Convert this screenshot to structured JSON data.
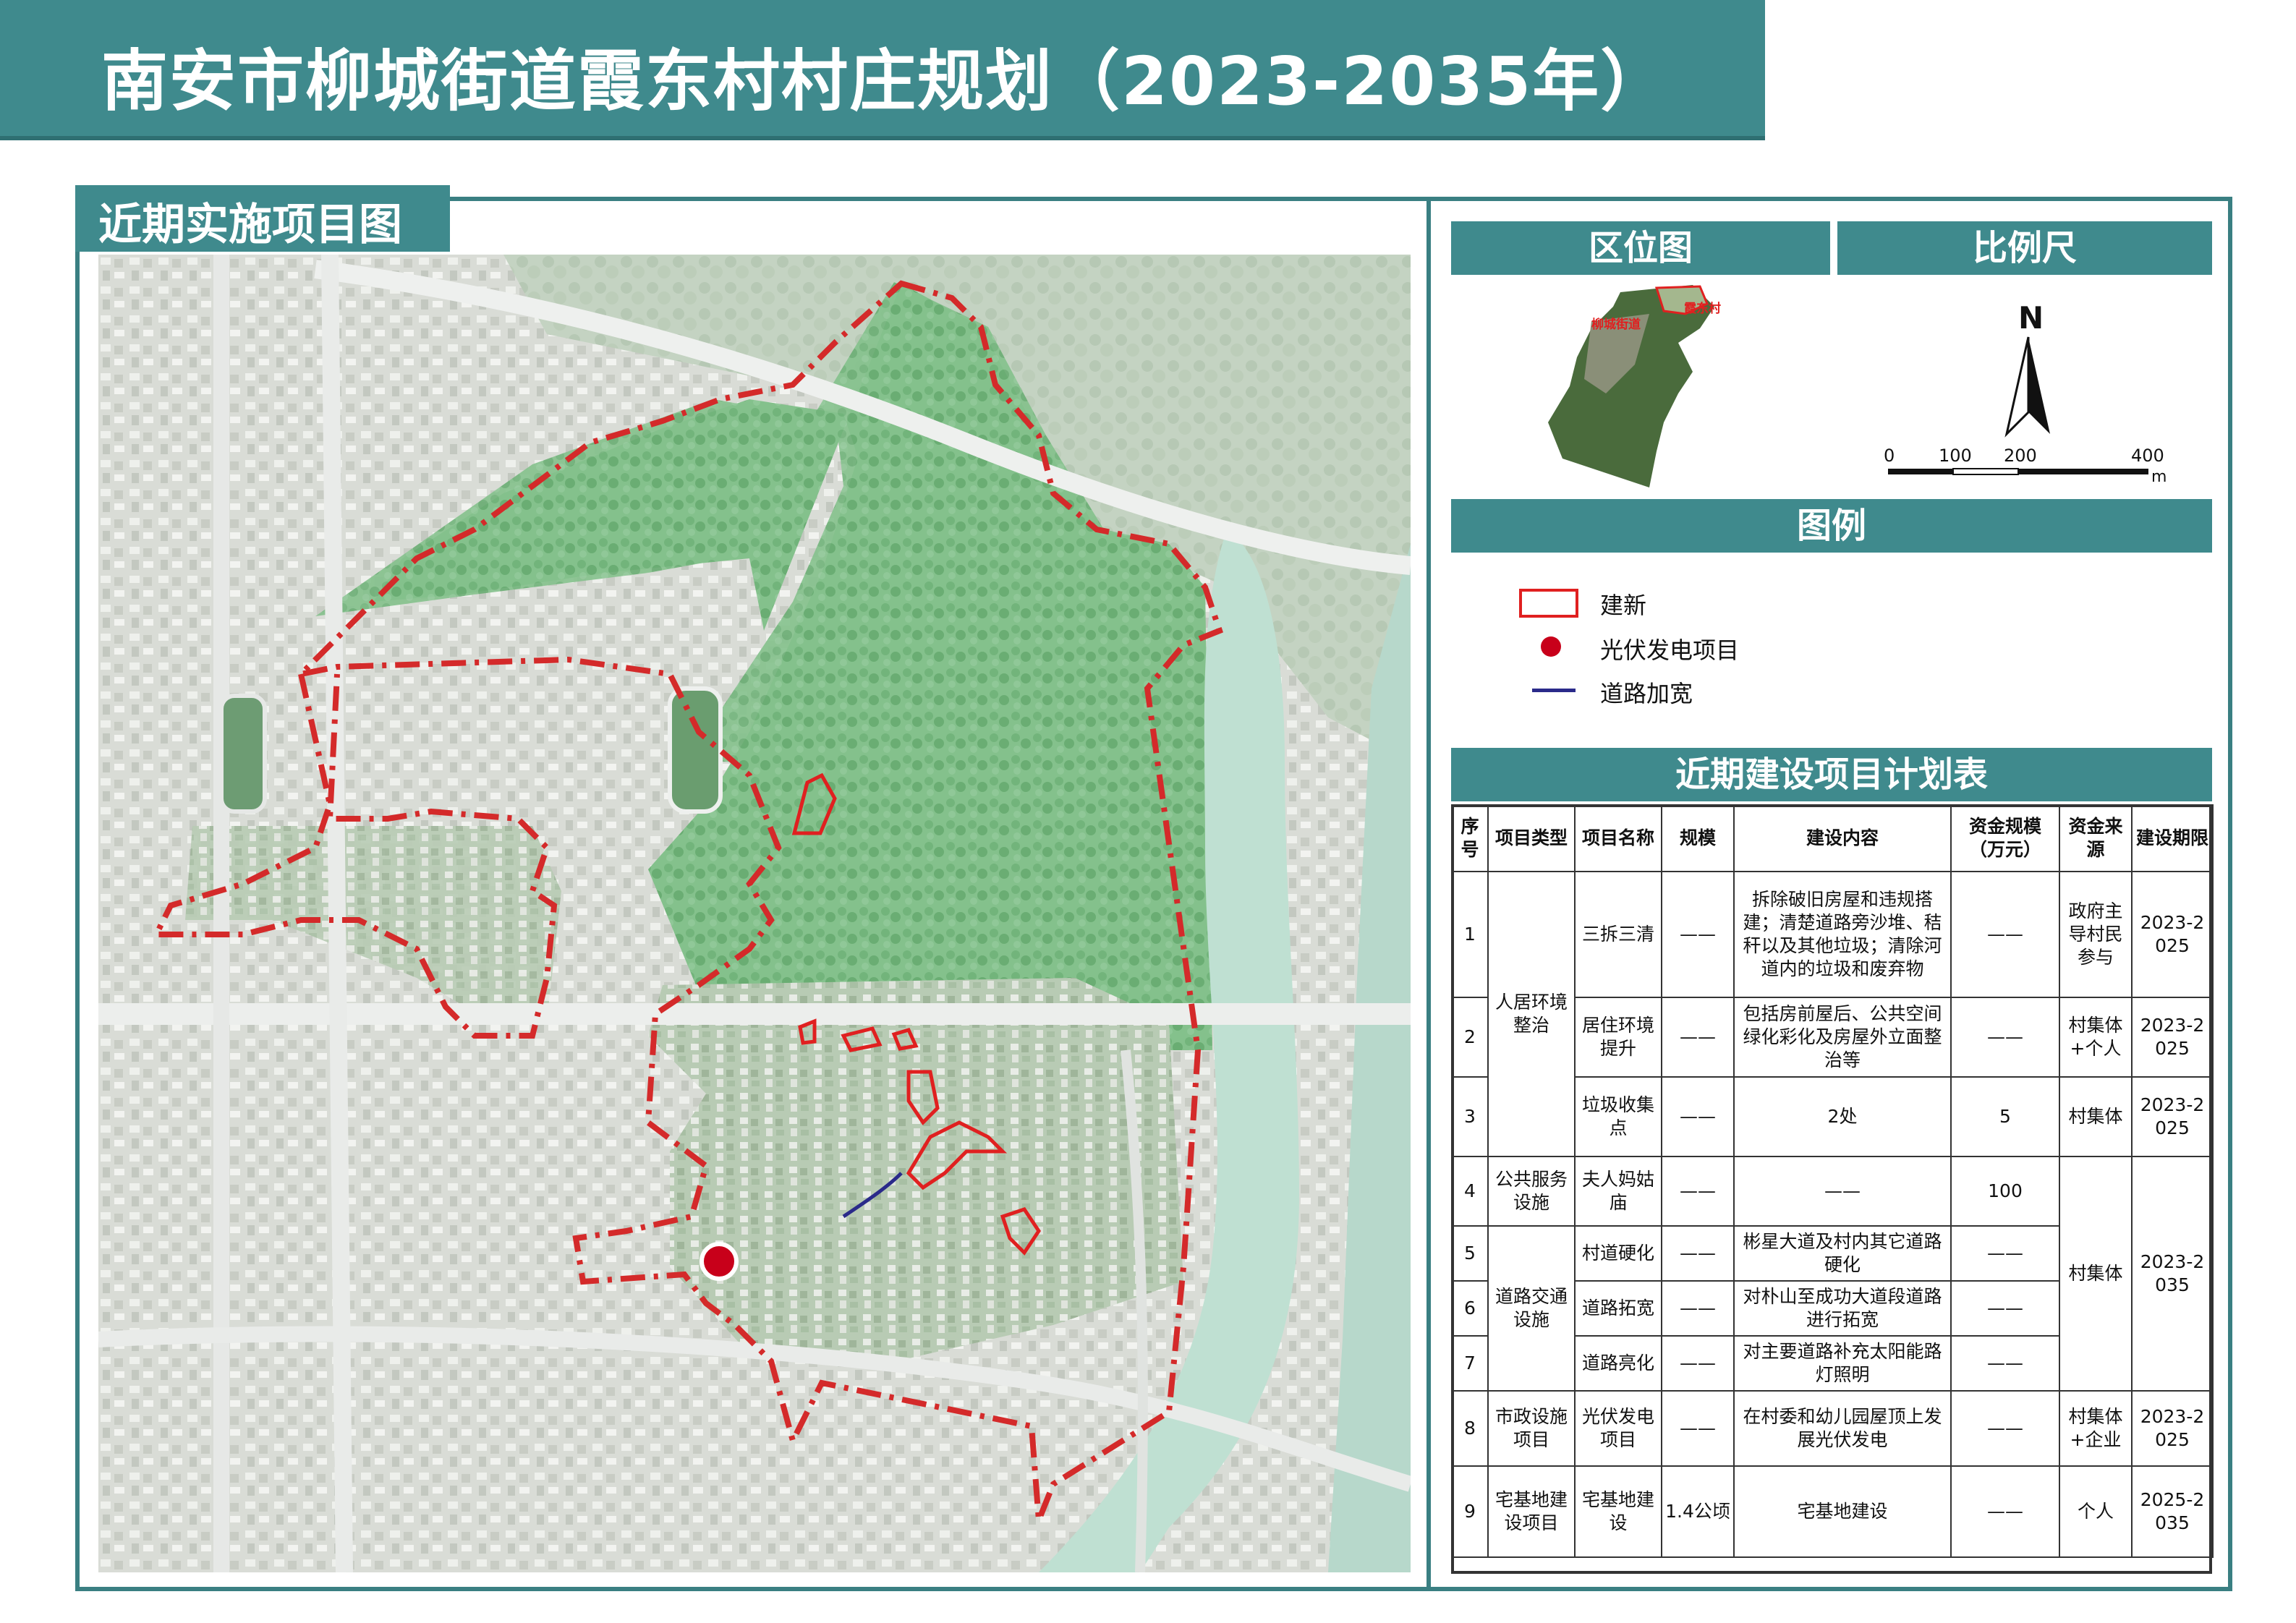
{
  "title": "南安市柳城街道霞东村村庄规划（2023-2035年）",
  "section_title": "近期实施项目图",
  "location_panel": {
    "header": "区位图",
    "label_street": "柳城街道",
    "label_village": "霞东村"
  },
  "scale_panel": {
    "header": "比例尺",
    "north": "N",
    "ticks": [
      "0",
      "100",
      "200",
      "400"
    ],
    "unit": "m"
  },
  "legend": {
    "header": "图例",
    "items": [
      {
        "label": "建新",
        "symbol": "red-outline-rect",
        "color": "#e02020"
      },
      {
        "label": "光伏发电项目",
        "symbol": "red-dot",
        "color": "#c8001a"
      },
      {
        "label": "道路加宽",
        "symbol": "blue-line",
        "color": "#2a2a8a"
      }
    ]
  },
  "colors": {
    "accent": "#3f8a8d",
    "boundary": "#d42a2a",
    "forest": "#7bbf83",
    "river": "#bfe0d2",
    "pv_dot": "#c8001a",
    "road_widen": "#2a2a8a"
  },
  "plan_table": {
    "header": "近期建设项目计划表",
    "columns": [
      "序号",
      "项目类型",
      "项目名称",
      "规模",
      "建设内容",
      "资金规模（万元）",
      "资金来源",
      "建设期限"
    ],
    "groups": {
      "g1": "人居环境整治",
      "g2": "公共服务设施",
      "g3": "道路交通设施",
      "g4": "市政设施项目",
      "g5": "宅基地建设项目"
    },
    "rows": [
      {
        "no": "1",
        "name": "三拆三清",
        "scale": "——",
        "content": "拆除破旧房屋和违规搭建；清楚道路旁沙堆、秸秆以及其他垃圾；清除河道内的垃圾和废弃物",
        "fund": "——",
        "source": "政府主导村民参与",
        "period": "2023-2025"
      },
      {
        "no": "2",
        "name": "居住环境提升",
        "scale": "——",
        "content": "包括房前屋后、公共空间绿化彩化及房屋外立面整治等",
        "fund": "——",
        "source": "村集体+个人",
        "period": "2023-2025"
      },
      {
        "no": "3",
        "name": "垃圾收集点",
        "scale": "——",
        "content": "2处",
        "fund": "5",
        "source": "村集体",
        "period": "2023-2025"
      },
      {
        "no": "4",
        "name": "夫人妈姑庙",
        "scale": "——",
        "content": "——",
        "fund": "100"
      },
      {
        "no": "5",
        "name": "村道硬化",
        "scale": "——",
        "content": "彬星大道及村内其它道路硬化",
        "fund": "——"
      },
      {
        "no": "6",
        "name": "道路拓宽",
        "scale": "——",
        "content": "对朴山至成功大道段道路进行拓宽",
        "fund": "——"
      },
      {
        "no": "7",
        "name": "道路亮化",
        "scale": "——",
        "content": "对主要道路补充太阳能路灯照明",
        "fund": "——"
      },
      {
        "no": "8",
        "name": "光伏发电项目",
        "scale": "——",
        "content": "在村委和幼儿园屋顶上发展光伏发电",
        "fund": "——",
        "source": "村集体+企业",
        "period": "2023-2025"
      },
      {
        "no": "9",
        "name": "宅基地建设",
        "scale": "1.4公顷",
        "content": "宅基地建设",
        "fund": "——",
        "source": "个人",
        "period": "2025-2035"
      }
    ],
    "merged": {
      "source_4_7": "村集体",
      "period_4_7": "2023-2035"
    }
  }
}
